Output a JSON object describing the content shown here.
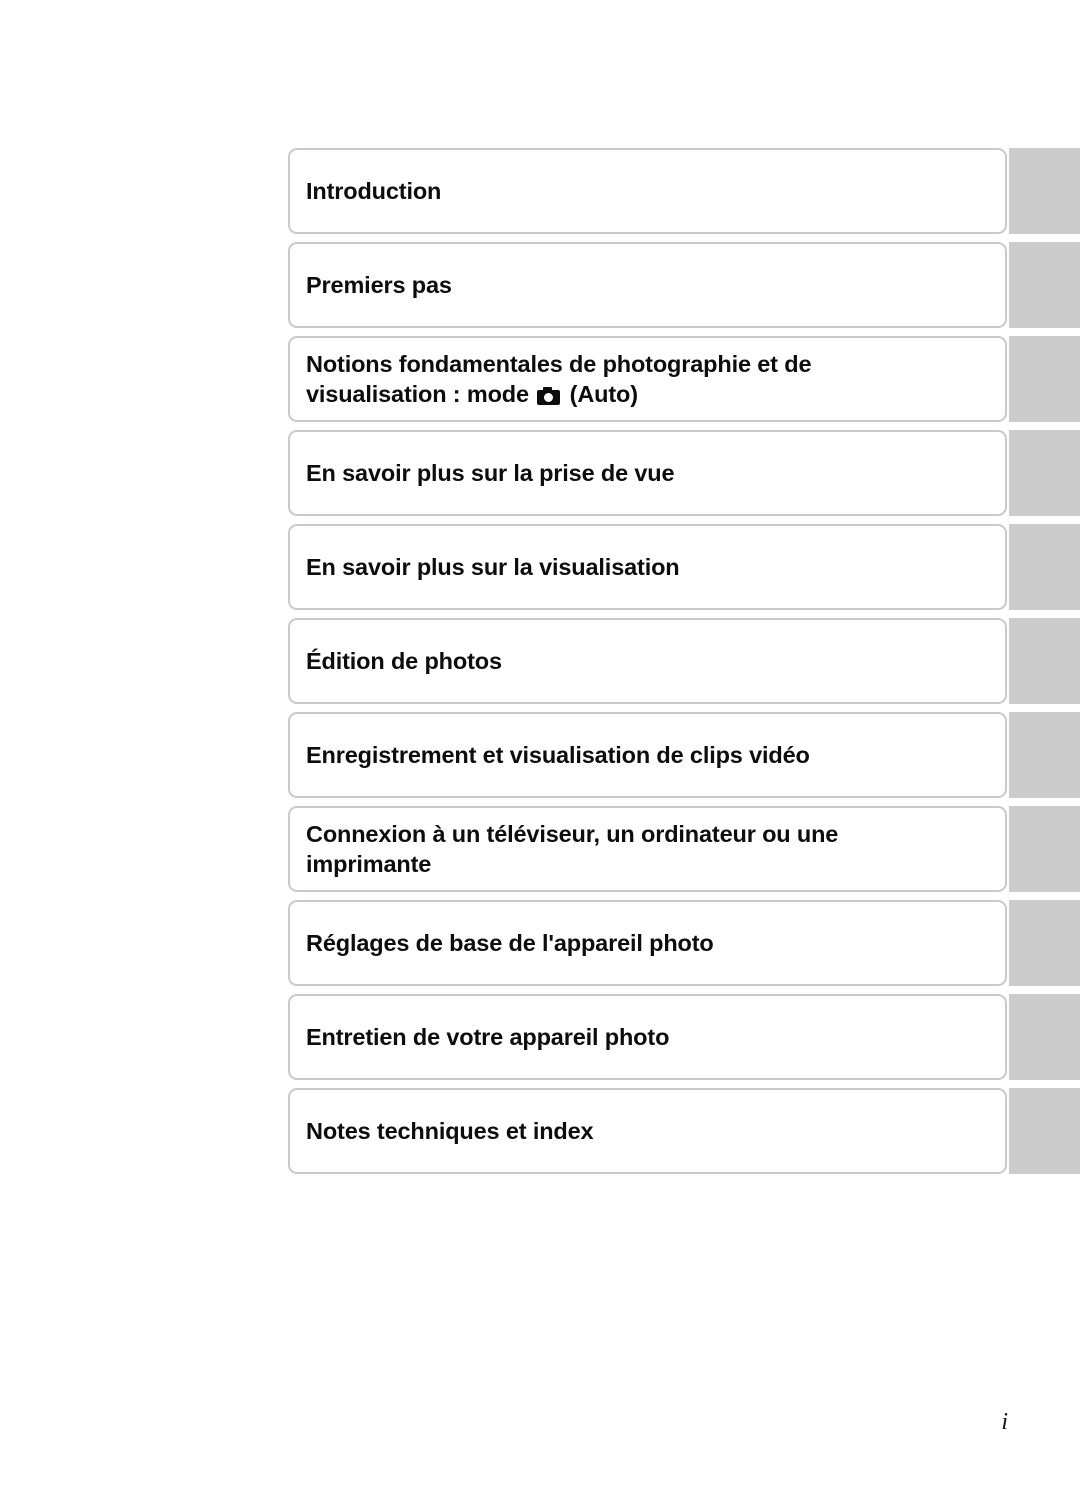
{
  "page": {
    "folio": "i",
    "background_color": "#ffffff",
    "thumb_color": "#cccccc",
    "box_border_color": "#c9c9c9",
    "text_color": "#0d0d0d"
  },
  "chapters": [
    {
      "id": "introduction",
      "label": "Introduction",
      "lines": [
        "Introduction"
      ],
      "has_icon": false
    },
    {
      "id": "premiers-pas",
      "label": "Premiers pas",
      "lines": [
        "Premiers pas"
      ],
      "has_icon": false
    },
    {
      "id": "notions-fondamentales",
      "label": "Notions fondamentales de photographie et de visualisation : mode  (Auto)",
      "lines": [
        "Notions fondamentales de photographie et de",
        "visualisation : mode "
      ],
      "line_tail": " (Auto)",
      "has_icon": true,
      "icon_name": "camera-auto-icon"
    },
    {
      "id": "prise-de-vue",
      "label": "En savoir plus sur la prise de vue",
      "lines": [
        "En savoir plus sur la prise de vue"
      ],
      "has_icon": false
    },
    {
      "id": "visualisation",
      "label": "En savoir plus sur la visualisation",
      "lines": [
        "En savoir plus sur la visualisation"
      ],
      "has_icon": false
    },
    {
      "id": "edition-photos",
      "label": "Édition de photos",
      "lines": [
        "Édition de photos"
      ],
      "has_icon": false
    },
    {
      "id": "clips-video",
      "label": "Enregistrement et visualisation de clips vidéo",
      "lines": [
        "Enregistrement et visualisation de clips vidéo"
      ],
      "has_icon": false
    },
    {
      "id": "connexion",
      "label": "Connexion à un téléviseur, un ordinateur ou une imprimante",
      "lines": [
        "Connexion à un téléviseur, un ordinateur ou une",
        "imprimante"
      ],
      "has_icon": false
    },
    {
      "id": "reglages-de-base",
      "label": "Réglages de base de l'appareil photo",
      "lines": [
        "Réglages de base de l'appareil photo"
      ],
      "has_icon": false
    },
    {
      "id": "entretien",
      "label": "Entretien de votre appareil photo",
      "lines": [
        "Entretien de votre appareil photo"
      ],
      "has_icon": false
    },
    {
      "id": "notes-techniques",
      "label": "Notes techniques et index",
      "lines": [
        "Notes techniques et index"
      ],
      "has_icon": false
    }
  ]
}
